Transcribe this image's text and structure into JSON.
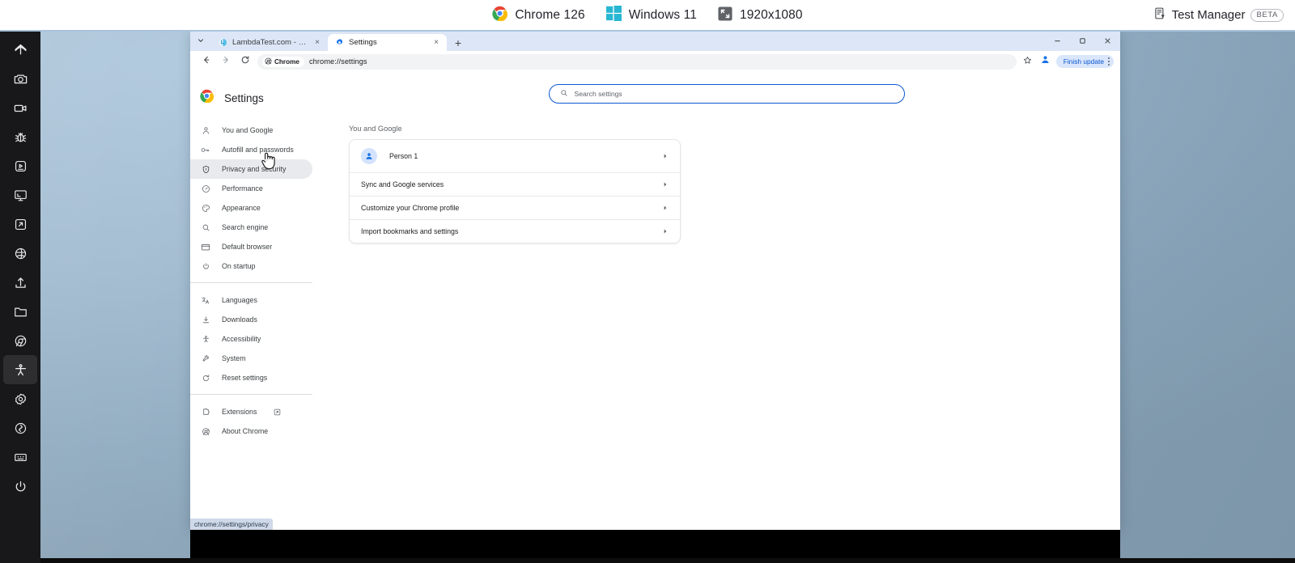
{
  "topbar": {
    "env": [
      {
        "icon": "chrome-icon",
        "label": "Chrome 126"
      },
      {
        "icon": "windows-icon",
        "label": "Windows 11"
      },
      {
        "icon": "resolution-icon",
        "label": "1920x1080"
      }
    ],
    "test_manager": {
      "icon": "test-manager-icon",
      "label": "Test Manager",
      "badge": "BETA"
    }
  },
  "rail": {
    "items": [
      {
        "name": "home-icon",
        "active": false
      },
      {
        "name": "screenshot-camera-icon",
        "active": false
      },
      {
        "name": "video-recorder-icon",
        "active": false
      },
      {
        "name": "bug-icon",
        "active": false
      },
      {
        "name": "test-run-icon",
        "active": false
      },
      {
        "name": "desktop-monitor-icon",
        "active": false
      },
      {
        "name": "external-link-icon",
        "active": false
      },
      {
        "name": "globe-chrome-icon",
        "active": false
      },
      {
        "name": "upload-icon",
        "active": false
      },
      {
        "name": "folder-icon",
        "active": false
      },
      {
        "name": "chrome-browser-icon",
        "active": false
      },
      {
        "name": "accessibility-person-icon",
        "active": true
      },
      {
        "name": "gear-settings-icon",
        "active": false
      },
      {
        "name": "refresh-sync-icon",
        "active": false
      },
      {
        "name": "keyboard-icon",
        "active": false
      },
      {
        "name": "power-icon",
        "active": false
      }
    ]
  },
  "browser": {
    "tabs": [
      {
        "title": "LambdaTest.com - Get Started",
        "favicon": "lambdatest-icon",
        "active": false,
        "close": "×"
      },
      {
        "title": "Settings",
        "favicon": "chrome-settings-icon",
        "active": true,
        "close": "×"
      }
    ],
    "new_tab_label": "+",
    "tab_search_icon": "chevron-down-icon",
    "window_controls": {
      "minimize": "–",
      "maximize": "❐",
      "close": "×"
    },
    "toolbar": {
      "back_icon": "arrow-left-icon",
      "forward_icon": "arrow-right-icon",
      "reload_icon": "reload-icon",
      "chip_icon": "chrome-mono-icon",
      "chip_label": "Chrome",
      "url": "chrome://settings",
      "bookmark_icon": "star-icon",
      "profile_icon": "profile-avatar-icon",
      "update_label": "Finish update",
      "menu_icon": "kebab-menu-icon"
    }
  },
  "settings": {
    "header": {
      "icon": "chrome-logo-icon",
      "title": "Settings"
    },
    "nav_groups": [
      [
        {
          "icon": "person-icon",
          "label": "You and Google",
          "selected": false
        },
        {
          "icon": "autofill-key-icon",
          "label": "Autofill and passwords",
          "selected": false
        },
        {
          "icon": "shield-icon",
          "label": "Privacy and security",
          "selected": true
        },
        {
          "icon": "performance-gauge-icon",
          "label": "Performance",
          "selected": false
        },
        {
          "icon": "palette-icon",
          "label": "Appearance",
          "selected": false
        },
        {
          "icon": "search-icon",
          "label": "Search engine",
          "selected": false
        },
        {
          "icon": "browser-window-icon",
          "label": "Default browser",
          "selected": false
        },
        {
          "icon": "power-icon",
          "label": "On startup",
          "selected": false
        }
      ],
      [
        {
          "icon": "languages-icon",
          "label": "Languages",
          "selected": false
        },
        {
          "icon": "download-icon",
          "label": "Downloads",
          "selected": false
        },
        {
          "icon": "accessibility-icon",
          "label": "Accessibility",
          "selected": false
        },
        {
          "icon": "system-wrench-icon",
          "label": "System",
          "selected": false
        },
        {
          "icon": "reset-icon",
          "label": "Reset settings",
          "selected": false
        }
      ],
      [
        {
          "icon": "extensions-puzzle-icon",
          "label": "Extensions",
          "selected": false,
          "trailing_icon": "external-link-icon"
        },
        {
          "icon": "about-chrome-icon",
          "label": "About Chrome",
          "selected": false
        }
      ]
    ],
    "search": {
      "icon": "search-icon",
      "placeholder": "Search settings",
      "value": ""
    },
    "section_title": "You and Google",
    "card_rows": [
      {
        "type": "profile",
        "avatar": "person-avatar-icon",
        "label": "Person 1",
        "chevron": "chevron-right-icon"
      },
      {
        "type": "row",
        "label": "Sync and Google services",
        "chevron": "chevron-right-icon"
      },
      {
        "type": "row",
        "label": "Customize your Chrome profile",
        "chevron": "chevron-right-icon"
      },
      {
        "type": "row",
        "label": "Import bookmarks and settings",
        "chevron": "chevron-right-icon"
      }
    ],
    "status_link": "chrome://settings/privacy"
  },
  "colors": {
    "accent_blue": "#0b57d0",
    "tabstrip": "#dce6f6",
    "selected_nav": "#e8eaed",
    "rail_bg": "#18181a",
    "update_chip": "#d9e6fb"
  }
}
